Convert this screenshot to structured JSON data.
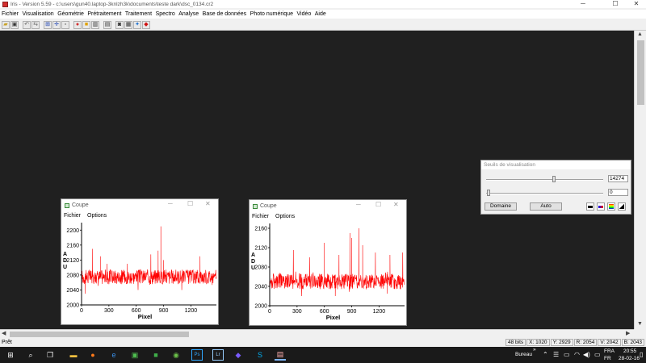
{
  "window": {
    "title": "Iris - Version 5.59 - c:\\users\\gun40.laptop-3knlzh3k\\documents\\teste dark\\dsc_0134.cr2"
  },
  "menu": [
    "Fichier",
    "Visualisation",
    "Géométrie",
    "Prétraitement",
    "Traitement",
    "Spectro",
    "Analyse",
    "Base de données",
    "Photo numérique",
    "Vidéo",
    "Aide"
  ],
  "toolbar_icons": [
    "open-folder-icon",
    "save-icon",
    "undo-icon",
    "redo-icon",
    "zoom-in-icon",
    "crosshair-icon",
    "zoom-fit-icon",
    "color-icon",
    "palette-icon",
    "histogram-icon",
    "settings-icon",
    "camera-icon",
    "tools-icon",
    "blue-star-icon",
    "red-diamond-icon"
  ],
  "status": {
    "text": "Prêt",
    "bits": "48 bits",
    "x": "X: 1020",
    "y": "Y: 2929",
    "r": "R: 2054",
    "v": "V: 2042",
    "b": "B: 2043"
  },
  "coupe1": {
    "title": "Coupe",
    "menu_fichier": "Fichier",
    "menu_options": "Options"
  },
  "coupe2": {
    "title": "Coupe",
    "menu_fichier": "Fichier",
    "menu_options": "Options"
  },
  "seuils": {
    "title": "Seuils de visualisation",
    "high_value": "14274",
    "low_value": "0",
    "high_slider_level": 0.58,
    "low_slider_level": 0.02,
    "domaine_label": "Domaine",
    "auto_label": "Auto"
  },
  "taskbar": {
    "bureau": "Bureau",
    "chevron": "»",
    "lang_top": "FRA",
    "lang_bottom": "FR",
    "time": "20:55",
    "date": "28-02-16"
  },
  "colors": {
    "signal": "#ff0000",
    "workspace": "#202020"
  },
  "chart_data": [
    {
      "type": "line",
      "title": "",
      "xlabel": "Pixel",
      "ylabel": "ADU",
      "xlim": [
        0,
        1480
      ],
      "ylim": [
        2000,
        2220
      ],
      "xticks": [
        0,
        300,
        600,
        900,
        1200
      ],
      "yticks": [
        2000,
        2040,
        2080,
        2120,
        2160,
        2200
      ],
      "baseline": 2075,
      "noise_amplitude": 20,
      "spikes": [
        {
          "x": 120,
          "y": 2150
        },
        {
          "x": 210,
          "y": 2130
        },
        {
          "x": 280,
          "y": 2110
        },
        {
          "x": 500,
          "y": 2110
        },
        {
          "x": 760,
          "y": 2135
        },
        {
          "x": 840,
          "y": 2145
        },
        {
          "x": 870,
          "y": 2210
        },
        {
          "x": 900,
          "y": 2120
        },
        {
          "x": 1300,
          "y": 2130
        }
      ],
      "dips": [
        {
          "x": 40,
          "y": 2030
        },
        {
          "x": 620,
          "y": 2040
        },
        {
          "x": 1100,
          "y": 2040
        }
      ]
    },
    {
      "type": "line",
      "title": "",
      "xlabel": "Pixel",
      "ylabel": "ADU",
      "xlim": [
        0,
        1480
      ],
      "ylim": [
        2000,
        2170
      ],
      "xticks": [
        0,
        300,
        600,
        900,
        1200
      ],
      "yticks": [
        2000,
        2040,
        2080,
        2120,
        2160
      ],
      "baseline": 2050,
      "noise_amplitude": 16,
      "spikes": [
        {
          "x": 260,
          "y": 2115
        },
        {
          "x": 440,
          "y": 2100
        },
        {
          "x": 600,
          "y": 2130
        },
        {
          "x": 760,
          "y": 2105
        },
        {
          "x": 880,
          "y": 2150
        },
        {
          "x": 900,
          "y": 2140
        },
        {
          "x": 980,
          "y": 2160
        },
        {
          "x": 1020,
          "y": 2125
        },
        {
          "x": 1160,
          "y": 2110
        },
        {
          "x": 1320,
          "y": 2105
        },
        {
          "x": 1460,
          "y": 2110
        }
      ],
      "dips": [
        {
          "x": 350,
          "y": 2020
        },
        {
          "x": 720,
          "y": 2020
        },
        {
          "x": 1290,
          "y": 2025
        }
      ]
    }
  ]
}
